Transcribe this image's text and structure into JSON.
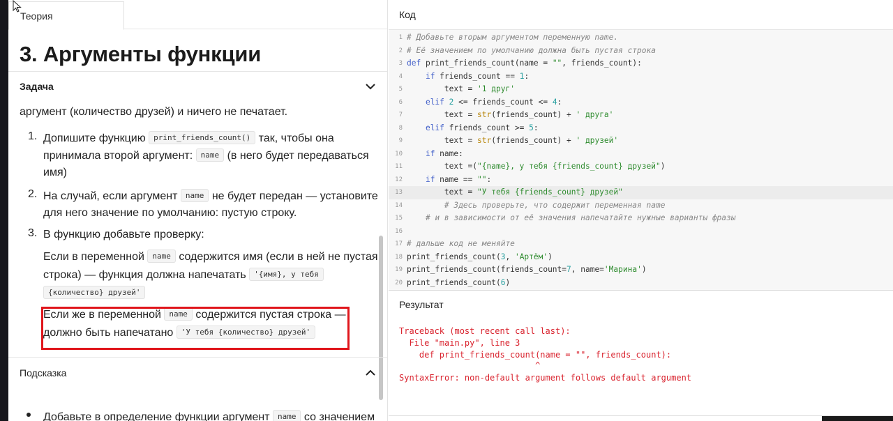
{
  "tab": {
    "label": "Теория"
  },
  "page_title": "3. Аргументы функции",
  "task": {
    "header": "Задача",
    "intro": "аргумент (количество друзей) и ничего не печатает.",
    "items": [
      {
        "num": "1.",
        "lines": [
          {
            "pre": "Допишите функцию ",
            "code": "print_friends_count()",
            "post": " так, чтобы она"
          },
          {
            "pre": "принимала второй аргумент: ",
            "code": "name",
            "post": " (в него будет передаваться"
          },
          {
            "pre": "имя)",
            "code": "",
            "post": ""
          }
        ]
      },
      {
        "num": "2.",
        "lines": [
          {
            "pre": "На случай, если аргумент ",
            "code": "name",
            "post": " не будет передан — установите"
          },
          {
            "pre": "для него значение по умолчанию: пустую строку.",
            "code": "",
            "post": ""
          }
        ]
      },
      {
        "num": "3.",
        "lines": [
          {
            "pre": "В функцию добавьте проверку:",
            "code": "",
            "post": ""
          }
        ]
      }
    ],
    "sub1_lines": [
      {
        "pre": "Если в переменной ",
        "code": "name",
        "post": " содержится имя (если в ней не пустая"
      },
      {
        "pre": "строка) — функция должна напечатать ",
        "code": "'{имя}, у тебя",
        "post": ""
      },
      {
        "pre": "",
        "code": "{количество} друзей'",
        "post": ""
      }
    ],
    "sub2_lines": [
      {
        "pre": "Если же в переменной ",
        "code": "name",
        "post": " содержится пустая строка —"
      },
      {
        "pre": "должно быть напечатано ",
        "code": "'У тебя {количество} друзей'",
        "post": ""
      }
    ]
  },
  "hint": {
    "header": "Подсказка",
    "line": {
      "pre": "Добавьте в определение функции аргумент ",
      "code": "name",
      "post": " со значением"
    }
  },
  "code_panel": {
    "header": "Код",
    "active_line": 13,
    "lines": [
      "# Добавьте вторым аргументом переменную name.",
      "# Её значением по умолчанию должна быть пустая строка",
      "def print_friends_count(name = \"\", friends_count):",
      "    if friends_count == 1:",
      "        text = '1 друг'",
      "    elif 2 <= friends_count <= 4:",
      "        text = str(friends_count) + ' друга'",
      "    elif friends_count >= 5:",
      "        text = str(friends_count) + ' друзей'",
      "    if name:",
      "        text =(\"{name}, у тебя {friends_count} друзей\")",
      "    if name == \"\":",
      "        text = \"У тебя {friends_count} друзей\"",
      "        # Здесь проверьте, что содержит переменная name",
      "    # и в зависимости от её значения напечатайте нужные варианты фразы",
      "",
      "# дальше код не меняйте",
      "print_friends_count(3, 'Артём')",
      "print_friends_count(friends_count=7, name='Марина')",
      "print_friends_count(6)"
    ]
  },
  "result": {
    "header": "Результат",
    "lines": [
      "Traceback (most recent call last):",
      "  File \"main.py\", line 3",
      "    def print_friends_count(name = \"\", friends_count):",
      "                           ^",
      "SyntaxError: non-default argument follows default argument"
    ]
  },
  "colors": {
    "keyword": "#3f5dc8",
    "string": "#2e8b2e",
    "comment": "#888888",
    "number": "#2aa1a1",
    "error": "#d9232e",
    "highlight_box": "#e0161c"
  },
  "icons": {
    "task_toggle": "chevron-down-icon",
    "hint_toggle": "chevron-up-icon",
    "cursor": "mouse-pointer-icon"
  }
}
